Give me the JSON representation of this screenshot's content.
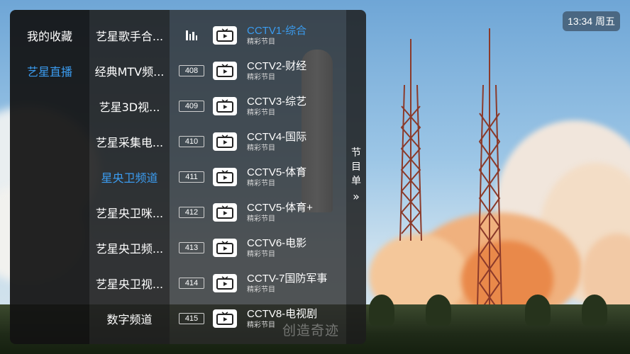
{
  "clock": {
    "text": "13:34 周五"
  },
  "categories": [
    {
      "label": "我的收藏",
      "active": false
    },
    {
      "label": "艺星直播",
      "active": true
    }
  ],
  "groups": [
    {
      "label": "艺星歌手合...",
      "active": false
    },
    {
      "label": "经典MTV频...",
      "active": false
    },
    {
      "label": "艺星3D视...",
      "active": false
    },
    {
      "label": "艺星采集电...",
      "active": false
    },
    {
      "label": "星央卫频道",
      "active": true
    },
    {
      "label": "艺星央卫咪...",
      "active": false
    },
    {
      "label": "艺星央卫频...",
      "active": false
    },
    {
      "label": "艺星央卫视...",
      "active": false
    },
    {
      "label": "数字频道",
      "active": false
    }
  ],
  "channels": [
    {
      "number": "",
      "playing": true,
      "name": "CCTV1-综合",
      "subtitle": "精彩节目"
    },
    {
      "number": "408",
      "playing": false,
      "name": "CCTV2-财经",
      "subtitle": "精彩节目"
    },
    {
      "number": "409",
      "playing": false,
      "name": "CCTV3-综艺",
      "subtitle": "精彩节目"
    },
    {
      "number": "410",
      "playing": false,
      "name": "CCTV4-国际",
      "subtitle": "精彩节目"
    },
    {
      "number": "411",
      "playing": false,
      "name": "CCTV5-体育",
      "subtitle": "精彩节目"
    },
    {
      "number": "412",
      "playing": false,
      "name": "CCTV5-体育+",
      "subtitle": "精彩节目"
    },
    {
      "number": "413",
      "playing": false,
      "name": "CCTV6-电影",
      "subtitle": "精彩节目"
    },
    {
      "number": "414",
      "playing": false,
      "name": "CCTV-7国防军事",
      "subtitle": "精彩节目"
    },
    {
      "number": "415",
      "playing": false,
      "name": "CCTV8-电视剧",
      "subtitle": "精彩节目"
    }
  ],
  "epg": {
    "chars": [
      "节",
      "目",
      "单"
    ],
    "icon": "double-chevron-right-icon"
  },
  "watermark": "创造奇迹",
  "colors": {
    "accent": "#3b9cf0"
  }
}
